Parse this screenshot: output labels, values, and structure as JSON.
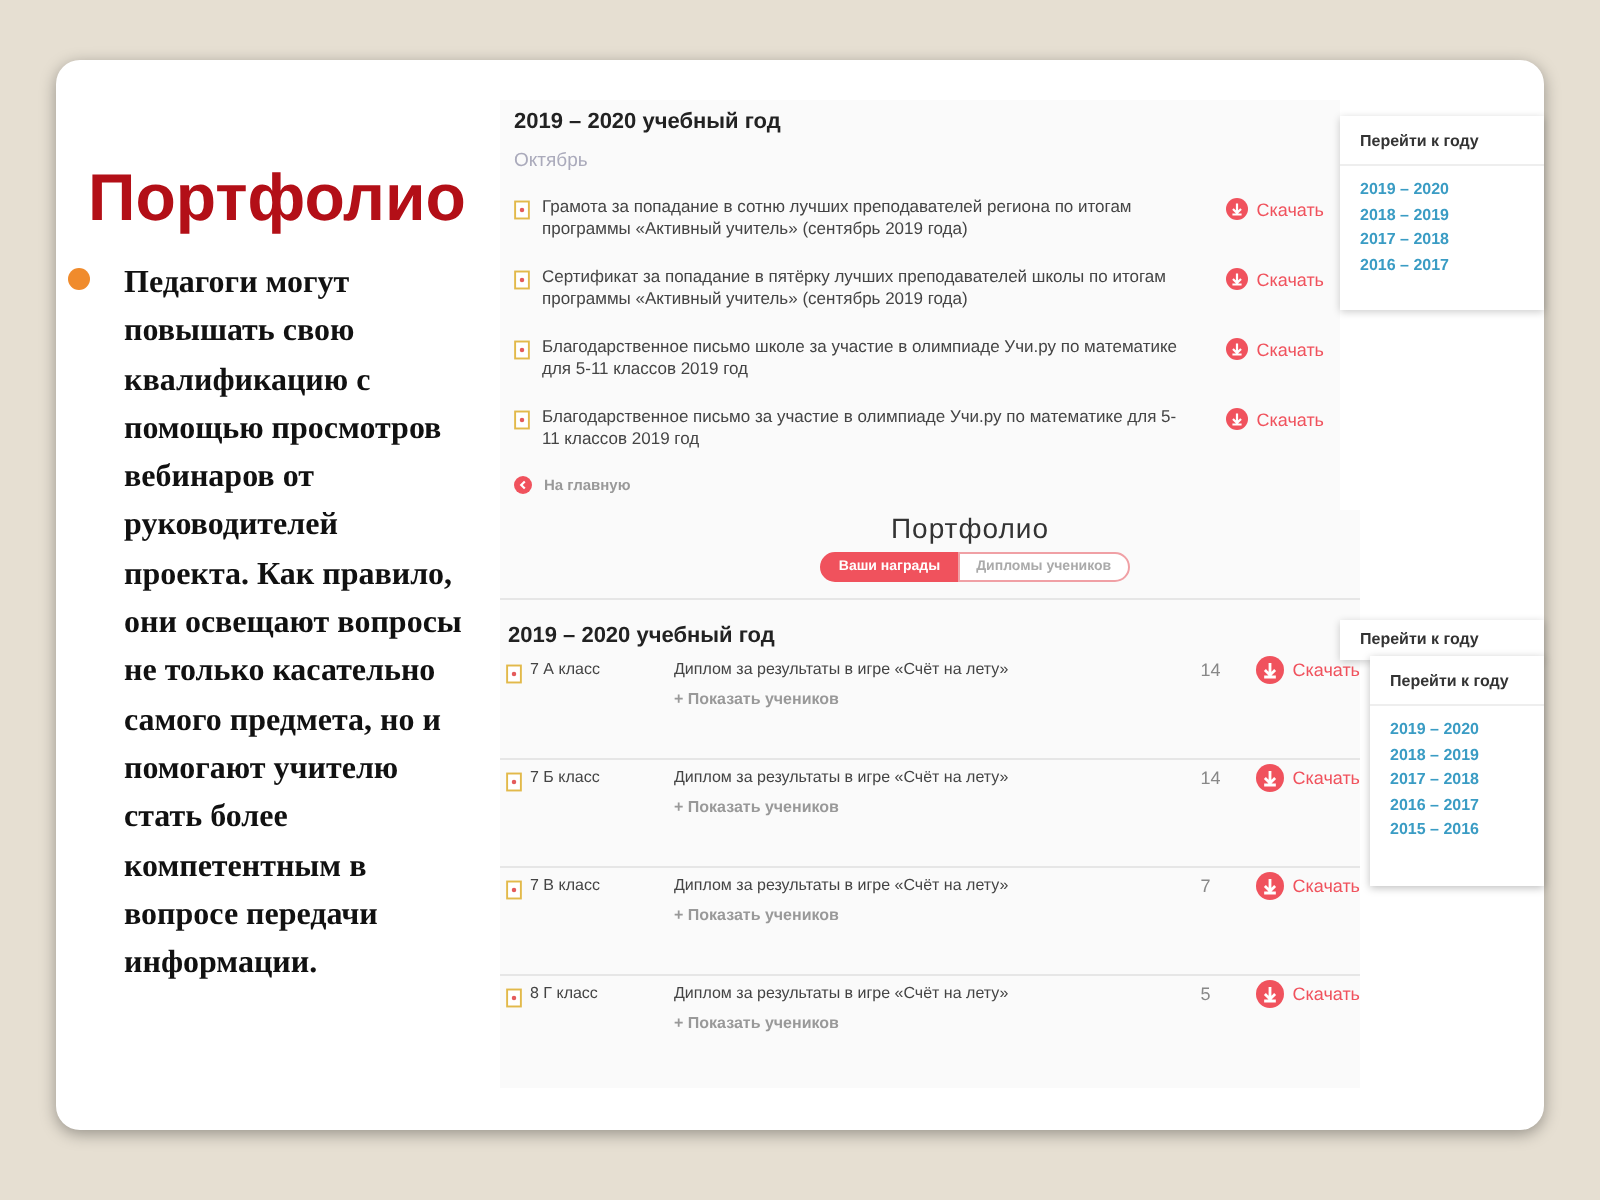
{
  "slide": {
    "title": "Портфолио",
    "bullets": [
      "Педагоги  могут повышать свою квалификацию с помощью просмотров вебинаров от руководителей проекта. Как правило, они освещают вопросы не только касательно самого предмета, но и помогают учителю стать более компетентным в вопросе передачи информации."
    ]
  },
  "awards_screen": {
    "year_heading": "2019 – 2020 учебный год",
    "month": "Октябрь",
    "items": [
      {
        "text": "Грамота за попадание в сотню лучших преподавателей региона по итогам программы «Активный учитель» (сентябрь 2019 года)",
        "action": "Скачать"
      },
      {
        "text": "Сертификат за попадание в пятёрку лучших преподавателей школы по итогам программы «Активный учитель» (сентябрь 2019 года)",
        "action": "Скачать"
      },
      {
        "text": "Благодарственное письмо школе за участие в олимпиаде Учи.ру по математике для 5-11 классов 2019 год",
        "action": "Скачать"
      },
      {
        "text": "Благодарственное письмо за участие в олимпиаде Учи.ру по математике для 5-11 классов 2019 год",
        "action": "Скачать"
      }
    ],
    "back_link": "На главную",
    "year_nav": {
      "title": "Перейти к году",
      "years": [
        "2019 – 2020",
        "2018 – 2019",
        "2017 – 2018",
        "2016 – 2017"
      ]
    }
  },
  "diplomas_screen": {
    "page_title": "Портфолио",
    "tabs": [
      {
        "label": "Ваши награды",
        "selected": true
      },
      {
        "label": "Дипломы учеников",
        "selected": false
      }
    ],
    "year_heading": "2019 – 2020 учебный год",
    "rows": [
      {
        "class_name": "7 А класс",
        "title": "Диплом за результаты в игре «Счёт на лету»",
        "show_students": "+ Показать учеников",
        "count": "14",
        "action": "Скачать"
      },
      {
        "class_name": "7 Б класс",
        "title": "Диплом за результаты в игре «Счёт на лету»",
        "show_students": "+ Показать учеников",
        "count": "14",
        "action": "Скачать"
      },
      {
        "class_name": "7 В класс",
        "title": "Диплом за результаты в игре «Счёт на лету»",
        "show_students": "+ Показать учеников",
        "count": "7",
        "action": "Скачать"
      },
      {
        "class_name": "8 Г класс",
        "title": "Диплом за результаты в игре «Счёт на лету»",
        "show_students": "+ Показать учеников",
        "count": "5",
        "action": "Скачать"
      }
    ],
    "year_nav_behind": {
      "title": "Перейти к году"
    },
    "year_nav": {
      "title": "Перейти к году",
      "years": [
        "2019 – 2020",
        "2018 – 2019",
        "2017 – 2018",
        "2016 – 2017",
        "2015 – 2016"
      ]
    }
  }
}
